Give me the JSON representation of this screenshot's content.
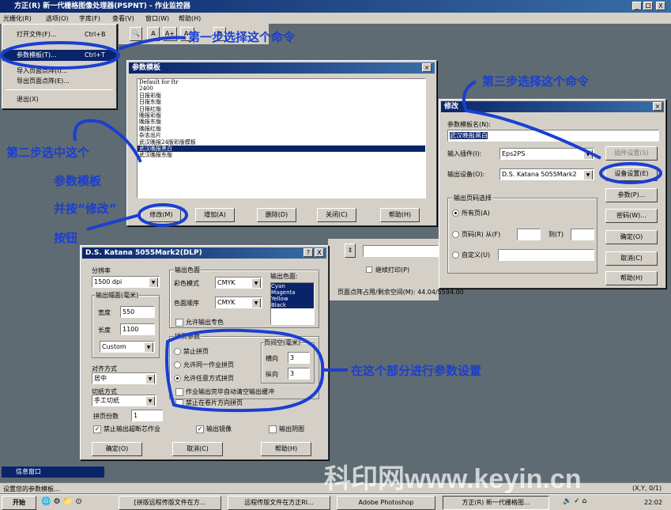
{
  "app": {
    "title": "方正(R) 新一代栅格图像处理器(PSPNT) - 作业监控器",
    "menu": [
      "光栅化(R)",
      "选项(O)",
      "字库(F)",
      "查看(V)",
      "窗口(W)",
      "帮助(H)"
    ],
    "window_controls": [
      "_",
      "ロ",
      "X"
    ]
  },
  "file_menu": {
    "items": [
      "打开文件(F)...",
      "参数模板(T)...",
      "导入页面点阵(I)...",
      "导出页面点阵(E)...",
      "退出(X)"
    ],
    "shortcuts": [
      "Ctrl+B",
      "Ctrl+T"
    ]
  },
  "template_dialog": {
    "title": "参数模板",
    "list": [
      "Default for ftr",
      "2400",
      "日报彩版",
      "日报东版",
      "日报红版",
      "晚报彩版",
      "晚报东版",
      "晚报红版",
      "杂志出片",
      "武汉晚报24版彩版模板",
      "武汉晚报黑白",
      "武汉晚报东版"
    ],
    "selected_index": 10,
    "buttons": [
      "修改(M)",
      "增加(A)",
      "删除(D)",
      "关闭(C)",
      "帮助(H)"
    ]
  },
  "modify_dialog": {
    "title": "修改",
    "name_label": "参数模板名(N):",
    "name_value": "武汉晚报黑白",
    "input_plugin_label": "输入插件(I):",
    "input_plugin_value": "Eps2PS",
    "plugin_settings_button": "插件设置(S)",
    "output_device_label": "输出设备(O):",
    "output_device_value": "D.S. Katana 5055Mark2",
    "device_settings_button": "设备设置(E)",
    "page_group_label": "输出页码选择",
    "page_options": [
      "所有页(A)",
      "页码(R) 从(F)",
      "自定义(U)"
    ],
    "to_label": "到(T)",
    "side_buttons": [
      "参数(P)...",
      "密码(W)...",
      "确定(O)",
      "取消(C)",
      "帮助(H)"
    ]
  },
  "katana_dialog": {
    "title": "D.S. Katana 5055Mark2(DLP)",
    "title_buttons": [
      "?",
      "X"
    ],
    "resolution_label": "分辨率",
    "resolution_value": "1500 dpi",
    "output_size_group": "输出幅面(毫米)",
    "width_label": "宽度",
    "width_value": "550",
    "length_label": "长度",
    "length_value": "1100",
    "size_preset": "Custom",
    "align_label": "对齐方式",
    "align_value": "居中",
    "cut_label": "切纸方式",
    "cut_value": "手工切纸",
    "copies_label": "拼页份数",
    "copies_value": "1",
    "output_color_group": "输出色面",
    "color_mode_label": "彩色模式",
    "color_mode_value": "CMYK",
    "color_order_label": "色面顺序",
    "color_order_value": "CMYK",
    "output_colors_label": "输出色面:",
    "output_colors": [
      "Cyan",
      "Magenta",
      "Yellow",
      "Black"
    ],
    "spot_color_label": "允许输出专色",
    "imposition_group": "拼页参数",
    "imposition_options": [
      "禁止拼页",
      "允许同一作业拼页",
      "允许任意方式拼页"
    ],
    "gap_group": "页间空(毫米)",
    "horizontal_label": "横向",
    "horizontal_value": "3",
    "vertical_label": "纵向",
    "vertical_value": "3",
    "check_clear_buffer": "作业输出完毕自动清空输出缓冲",
    "check_forbid_roll": "禁止在卷片方向拼页",
    "check_forbid_overflow": "禁止输出超断芯作业",
    "check_mirror": "输出镜像",
    "check_negative": "输出阴图",
    "buttons": [
      "确定(O)",
      "取消(C)",
      "帮助(H)"
    ]
  },
  "background_panel": {
    "continue_print": "继续打印(P)",
    "status": "页面点阵占用/剩余空间(M): 44.04/5594.00"
  },
  "annotations": {
    "step1": "第一步选择这个命令",
    "step2_line1": "第二步选中这个",
    "step2_line2": "参数模板",
    "step2_line3": "并按“修改”",
    "step2_line4": "按钮",
    "step3": "第三步选择这个命令",
    "params": "在这个部分进行参数设置"
  },
  "statusbar": {
    "info_window": "信息窗口",
    "hint": "设置您的参数模板...",
    "coords": "(X,Y, 0/1)"
  },
  "taskbar": {
    "start": "开始",
    "tasks": [
      "[拼版远程传版文件在方...",
      "远程传版文件在方正RI...",
      "Adobe Photoshop",
      "方正(R) 新一代栅格图..."
    ],
    "clock": "22:02"
  },
  "watermark": "科印网www.keyin.cn",
  "colors": {
    "annotation": "#1a3fd0",
    "titlebar": "#0a246a",
    "selection": "#0a246a",
    "desktop": "#5f6b73"
  }
}
